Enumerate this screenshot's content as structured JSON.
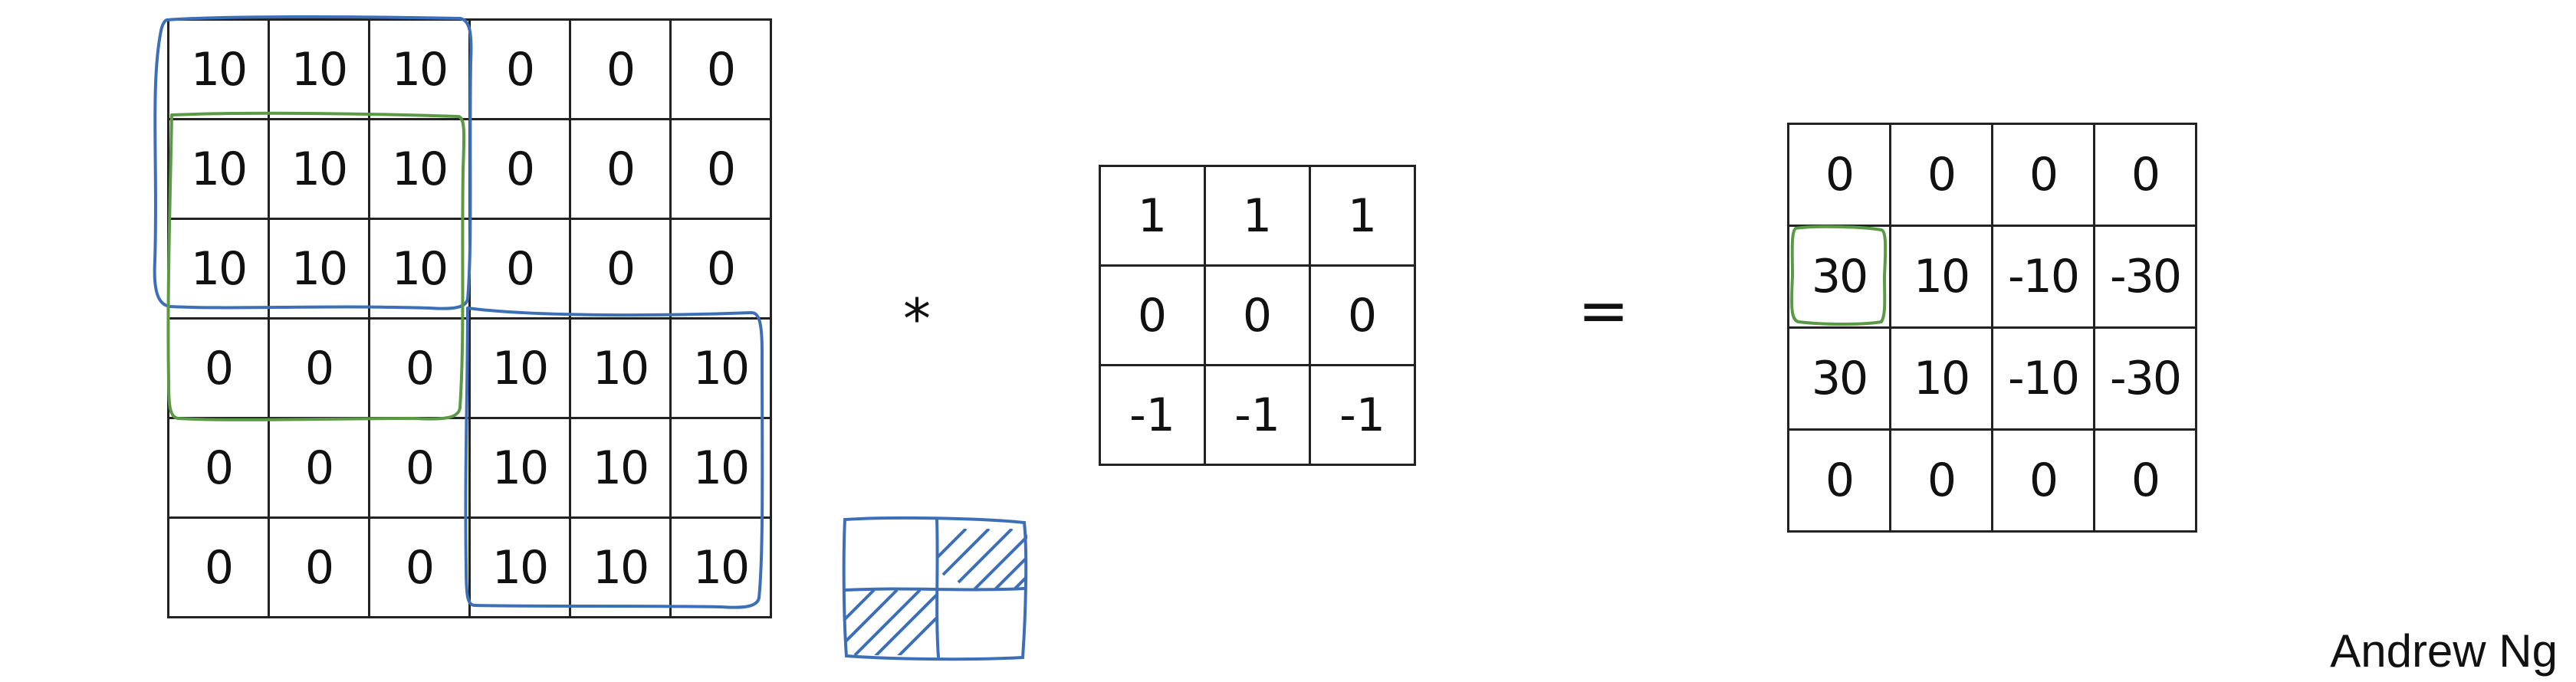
{
  "input_matrix": [
    [
      "10",
      "10",
      "10",
      "0",
      "0",
      "0"
    ],
    [
      "10",
      "10",
      "10",
      "0",
      "0",
      "0"
    ],
    [
      "10",
      "10",
      "10",
      "0",
      "0",
      "0"
    ],
    [
      "0",
      "0",
      "0",
      "10",
      "10",
      "10"
    ],
    [
      "0",
      "0",
      "0",
      "10",
      "10",
      "10"
    ],
    [
      "0",
      "0",
      "0",
      "10",
      "10",
      "10"
    ]
  ],
  "filter_matrix": [
    [
      "1",
      "1",
      "1"
    ],
    [
      "0",
      "0",
      "0"
    ],
    [
      "-1",
      "-1",
      "-1"
    ]
  ],
  "output_matrix": [
    [
      "0",
      "0",
      "0",
      "0"
    ],
    [
      "30",
      "10",
      "-10",
      "-30"
    ],
    [
      "30",
      "10",
      "-10",
      "-30"
    ],
    [
      "0",
      "0",
      "0",
      "0"
    ]
  ],
  "operators": {
    "convolution": "*",
    "equals": "="
  },
  "credit": "Andrew Ng",
  "colors": {
    "annotation_blue": "#3d6fb8",
    "annotation_green": "#5a9a45"
  }
}
